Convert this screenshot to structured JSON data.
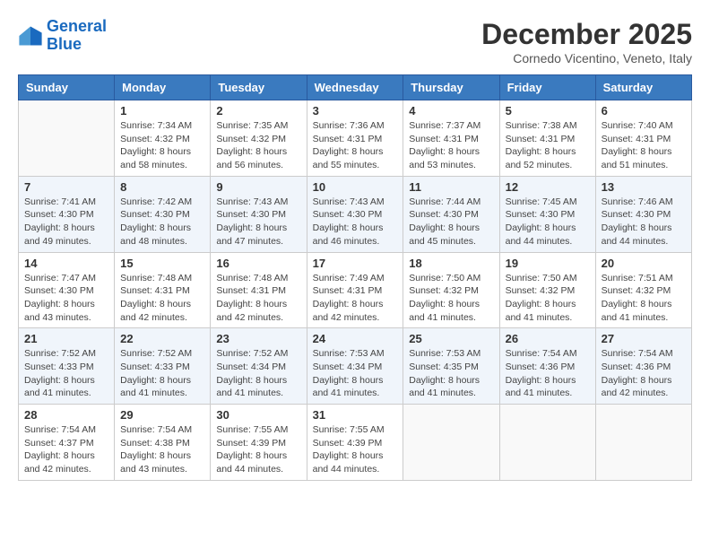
{
  "logo": {
    "line1": "General",
    "line2": "Blue"
  },
  "title": "December 2025",
  "subtitle": "Cornedo Vicentino, Veneto, Italy",
  "days_of_week": [
    "Sunday",
    "Monday",
    "Tuesday",
    "Wednesday",
    "Thursday",
    "Friday",
    "Saturday"
  ],
  "weeks": [
    [
      {
        "day": "",
        "info": ""
      },
      {
        "day": "1",
        "info": "Sunrise: 7:34 AM\nSunset: 4:32 PM\nDaylight: 8 hours\nand 58 minutes."
      },
      {
        "day": "2",
        "info": "Sunrise: 7:35 AM\nSunset: 4:32 PM\nDaylight: 8 hours\nand 56 minutes."
      },
      {
        "day": "3",
        "info": "Sunrise: 7:36 AM\nSunset: 4:31 PM\nDaylight: 8 hours\nand 55 minutes."
      },
      {
        "day": "4",
        "info": "Sunrise: 7:37 AM\nSunset: 4:31 PM\nDaylight: 8 hours\nand 53 minutes."
      },
      {
        "day": "5",
        "info": "Sunrise: 7:38 AM\nSunset: 4:31 PM\nDaylight: 8 hours\nand 52 minutes."
      },
      {
        "day": "6",
        "info": "Sunrise: 7:40 AM\nSunset: 4:31 PM\nDaylight: 8 hours\nand 51 minutes."
      }
    ],
    [
      {
        "day": "7",
        "info": "Sunrise: 7:41 AM\nSunset: 4:30 PM\nDaylight: 8 hours\nand 49 minutes."
      },
      {
        "day": "8",
        "info": "Sunrise: 7:42 AM\nSunset: 4:30 PM\nDaylight: 8 hours\nand 48 minutes."
      },
      {
        "day": "9",
        "info": "Sunrise: 7:43 AM\nSunset: 4:30 PM\nDaylight: 8 hours\nand 47 minutes."
      },
      {
        "day": "10",
        "info": "Sunrise: 7:43 AM\nSunset: 4:30 PM\nDaylight: 8 hours\nand 46 minutes."
      },
      {
        "day": "11",
        "info": "Sunrise: 7:44 AM\nSunset: 4:30 PM\nDaylight: 8 hours\nand 45 minutes."
      },
      {
        "day": "12",
        "info": "Sunrise: 7:45 AM\nSunset: 4:30 PM\nDaylight: 8 hours\nand 44 minutes."
      },
      {
        "day": "13",
        "info": "Sunrise: 7:46 AM\nSunset: 4:30 PM\nDaylight: 8 hours\nand 44 minutes."
      }
    ],
    [
      {
        "day": "14",
        "info": "Sunrise: 7:47 AM\nSunset: 4:30 PM\nDaylight: 8 hours\nand 43 minutes."
      },
      {
        "day": "15",
        "info": "Sunrise: 7:48 AM\nSunset: 4:31 PM\nDaylight: 8 hours\nand 42 minutes."
      },
      {
        "day": "16",
        "info": "Sunrise: 7:48 AM\nSunset: 4:31 PM\nDaylight: 8 hours\nand 42 minutes."
      },
      {
        "day": "17",
        "info": "Sunrise: 7:49 AM\nSunset: 4:31 PM\nDaylight: 8 hours\nand 42 minutes."
      },
      {
        "day": "18",
        "info": "Sunrise: 7:50 AM\nSunset: 4:32 PM\nDaylight: 8 hours\nand 41 minutes."
      },
      {
        "day": "19",
        "info": "Sunrise: 7:50 AM\nSunset: 4:32 PM\nDaylight: 8 hours\nand 41 minutes."
      },
      {
        "day": "20",
        "info": "Sunrise: 7:51 AM\nSunset: 4:32 PM\nDaylight: 8 hours\nand 41 minutes."
      }
    ],
    [
      {
        "day": "21",
        "info": "Sunrise: 7:52 AM\nSunset: 4:33 PM\nDaylight: 8 hours\nand 41 minutes."
      },
      {
        "day": "22",
        "info": "Sunrise: 7:52 AM\nSunset: 4:33 PM\nDaylight: 8 hours\nand 41 minutes."
      },
      {
        "day": "23",
        "info": "Sunrise: 7:52 AM\nSunset: 4:34 PM\nDaylight: 8 hours\nand 41 minutes."
      },
      {
        "day": "24",
        "info": "Sunrise: 7:53 AM\nSunset: 4:34 PM\nDaylight: 8 hours\nand 41 minutes."
      },
      {
        "day": "25",
        "info": "Sunrise: 7:53 AM\nSunset: 4:35 PM\nDaylight: 8 hours\nand 41 minutes."
      },
      {
        "day": "26",
        "info": "Sunrise: 7:54 AM\nSunset: 4:36 PM\nDaylight: 8 hours\nand 41 minutes."
      },
      {
        "day": "27",
        "info": "Sunrise: 7:54 AM\nSunset: 4:36 PM\nDaylight: 8 hours\nand 42 minutes."
      }
    ],
    [
      {
        "day": "28",
        "info": "Sunrise: 7:54 AM\nSunset: 4:37 PM\nDaylight: 8 hours\nand 42 minutes."
      },
      {
        "day": "29",
        "info": "Sunrise: 7:54 AM\nSunset: 4:38 PM\nDaylight: 8 hours\nand 43 minutes."
      },
      {
        "day": "30",
        "info": "Sunrise: 7:55 AM\nSunset: 4:39 PM\nDaylight: 8 hours\nand 44 minutes."
      },
      {
        "day": "31",
        "info": "Sunrise: 7:55 AM\nSunset: 4:39 PM\nDaylight: 8 hours\nand 44 minutes."
      },
      {
        "day": "",
        "info": ""
      },
      {
        "day": "",
        "info": ""
      },
      {
        "day": "",
        "info": ""
      }
    ]
  ]
}
